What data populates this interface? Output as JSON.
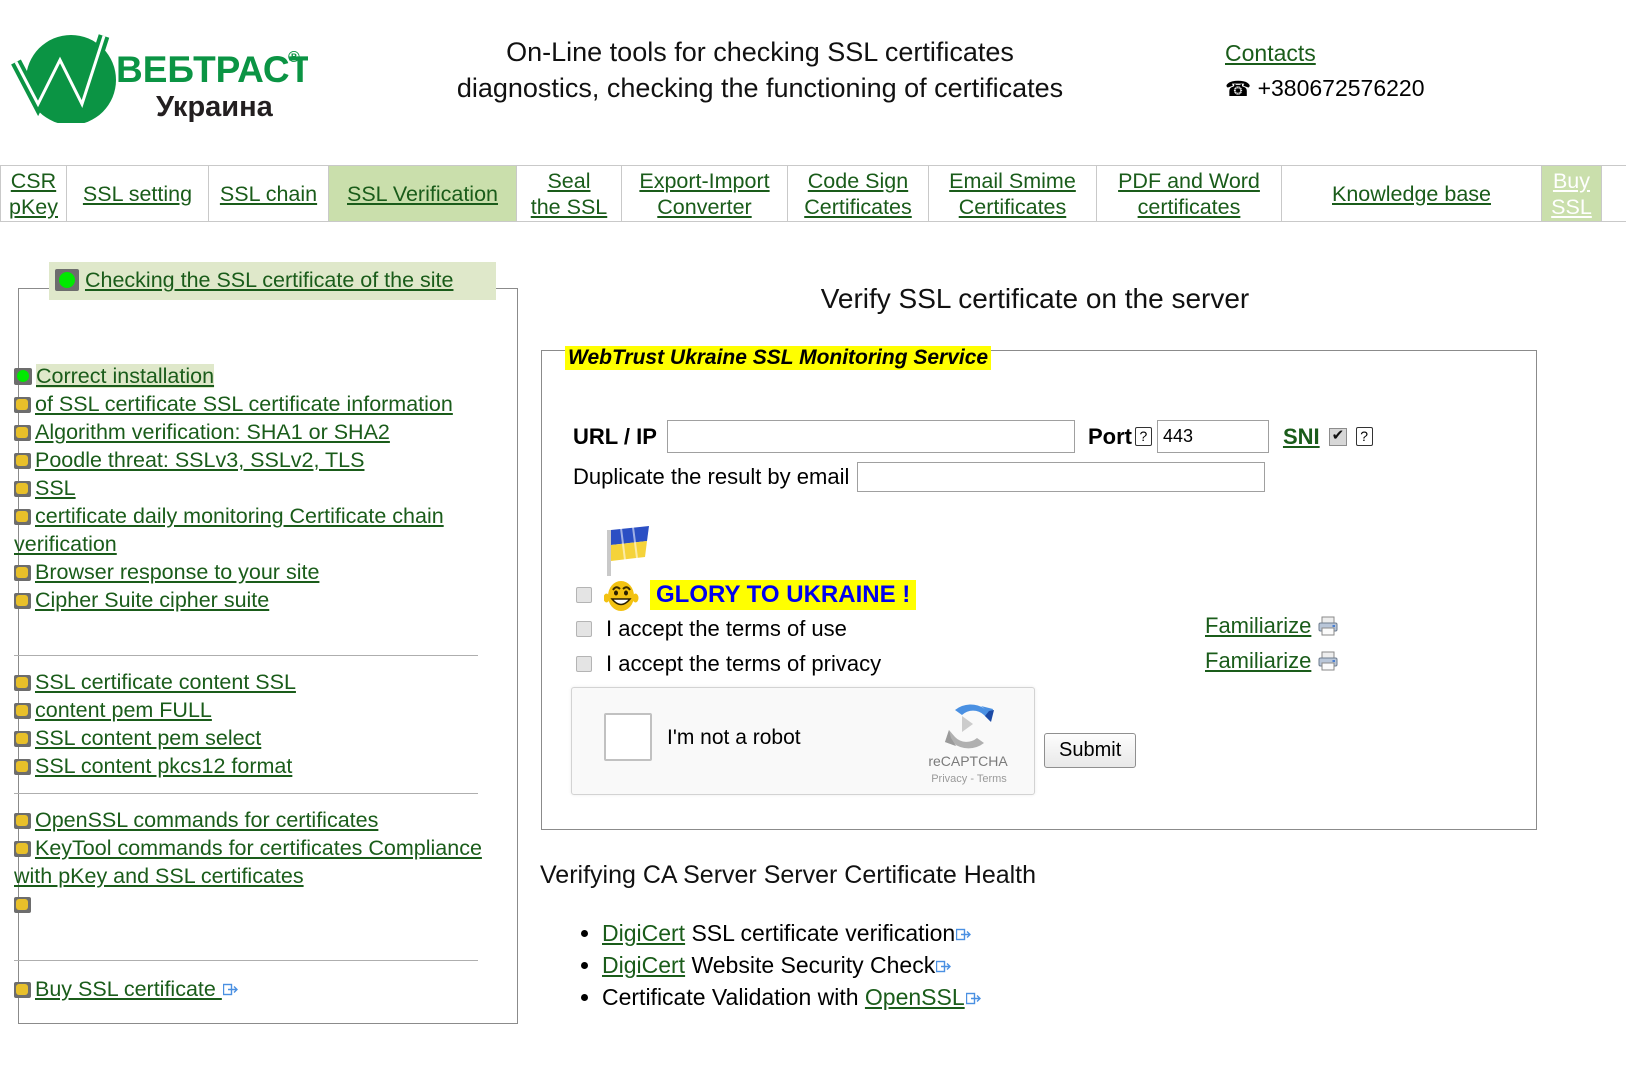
{
  "header": {
    "logo_main": "ВЕБТРАСТ",
    "logo_reg": "®",
    "logo_sub": "Украина",
    "title_line1": "On-Line tools for checking SSL certificates",
    "title_line2": "diagnostics, checking the functioning of certificates",
    "contacts_label": "Contacts",
    "phone_glyph": "☎",
    "phone": "+380672576220"
  },
  "nav": {
    "items": [
      {
        "label_line1": "CSR",
        "label_line2": "pKey",
        "state": "normal",
        "width_class": "nav-w-csr"
      },
      {
        "label_line1": "",
        "label_line2": "SSL setting",
        "state": "normal",
        "width_class": "nav-w-setting"
      },
      {
        "label_line1": "",
        "label_line2": "SSL chain",
        "state": "normal",
        "width_class": "nav-w-chain"
      },
      {
        "label_line1": "",
        "label_line2": "SSL Verification",
        "state": "active",
        "width_class": "nav-w-verif"
      },
      {
        "label_line1": "Seal",
        "label_line2": "the SSL",
        "state": "normal",
        "width_class": "nav-w-seal"
      },
      {
        "label_line1": "Export-Import",
        "label_line2": "Converter",
        "state": "normal",
        "width_class": "nav-w-export"
      },
      {
        "label_line1": "Code Sign",
        "label_line2": "Certificates",
        "state": "normal",
        "width_class": "nav-w-code"
      },
      {
        "label_line1": "Email Smime",
        "label_line2": "Certificates",
        "state": "normal",
        "width_class": "nav-w-email"
      },
      {
        "label_line1": "PDF and Word",
        "label_line2": "certificates",
        "state": "normal",
        "width_class": "nav-w-pdf"
      },
      {
        "label_line1": "",
        "label_line2": "Knowledge base",
        "state": "normal",
        "width_class": "nav-w-kb"
      },
      {
        "label_line1": "Buy",
        "label_line2": "SSL",
        "state": "buy",
        "width_class": "nav-w-buy"
      }
    ]
  },
  "sidebar": {
    "title": "Checking the SSL certificate of the site",
    "title_icon": "green-light-icon",
    "group1": [
      {
        "label": "Correct installation ",
        "icon": "green-bullet-icon",
        "highlight": true
      },
      {
        "label": "of SSL certificate SSL certificate information ",
        "icon": "gold-bullet-icon",
        "highlight": false
      },
      {
        "label": "Algorithm verification: SHA1 or SHA2 ",
        "icon": "gold-bullet-icon",
        "highlight": false
      },
      {
        "label": "Poodle threat: SSLv3, SSLv2, TLS ",
        "icon": "gold-bullet-icon",
        "highlight": false
      },
      {
        "label": "SSL ",
        "icon": "gold-bullet-icon",
        "highlight": false
      },
      {
        "label": "certificate daily monitoring Certificate chain verification ",
        "icon": "gold-bullet-icon",
        "highlight": false
      },
      {
        "label": "Browser response to your site ",
        "icon": "gold-bullet-icon",
        "highlight": false
      },
      {
        "label": "Cipher Suite cipher suite",
        "icon": "gold-bullet-icon",
        "highlight": false
      }
    ],
    "group2": [
      {
        "label": "SSL certificate content SSL ",
        "icon": "gold-bullet-icon"
      },
      {
        "label": "content pem FULL ",
        "icon": "gold-bullet-icon"
      },
      {
        "label": "SSL content pem select ",
        "icon": "gold-bullet-icon"
      },
      {
        "label": "SSL content pkcs12 format",
        "icon": "gold-bullet-icon"
      }
    ],
    "group3": [
      {
        "label": "OpenSSL commands for certificates ",
        "icon": "gold-bullet-icon"
      },
      {
        "label": "KeyTool commands for certificates Compliance with pKey and SSL certificates",
        "icon": "gold-bullet-icon"
      },
      {
        "label": "",
        "icon": "gold-bullet-icon"
      }
    ],
    "group4": [
      {
        "label": "Buy SSL certificate ",
        "icon": "gold-bullet-icon",
        "external": true
      }
    ]
  },
  "main": {
    "title": "Verify SSL certificate on the server",
    "legend": "WebTrust Ukraine SSL Monitoring Service",
    "url_label": "URL / IP",
    "url_value": "",
    "url_help_icon": "question-icon",
    "port_label": "Port",
    "port_help_icon": "question-icon",
    "port_value": "443",
    "sni_label": "SNI",
    "sni_checked": true,
    "sni_help_icon": "question-icon",
    "email_label": "Duplicate the result by email",
    "email_value": "",
    "flag_icon": "ukraine-flag-icon",
    "smiley_icon": "smiley-face-icon",
    "glory_text": "GLORY TO UKRAINE !",
    "glory_checked": false,
    "terms_use_label": "I accept the terms of use",
    "terms_use_checked": false,
    "terms_privacy_label": "I accept the terms of privacy",
    "terms_privacy_checked": false,
    "familiarize_1": "Familiarize",
    "familiarize_2": "Familiarize",
    "printer_icon": "printer-icon",
    "recaptcha": {
      "label": "I'm not a robot",
      "brand": "reCAPTCHA",
      "privacy": "Privacy - Terms",
      "logo_icon": "recaptcha-logo-icon",
      "checked": false
    },
    "submit_label": "Submit"
  },
  "ca_section": {
    "heading": "Verifying CA Server Server Certificate Health",
    "items": [
      {
        "link": "DigiCert",
        "rest": " SSL certificate verification",
        "external_icon": "external-link-icon"
      },
      {
        "link": "DigiCert",
        "rest": " Website Security Check",
        "external_icon": "external-link-icon"
      },
      {
        "prefix": "Certificate Validation with ",
        "link": "OpenSSL",
        "rest": "",
        "external_icon": "external-link-icon"
      }
    ]
  },
  "colors": {
    "brand_green": "#0b9444",
    "link_green": "#1a5c1a",
    "nav_active": "#cadfac",
    "highlight_yellow": "#ffff00",
    "glory_blue": "#0000ee"
  }
}
